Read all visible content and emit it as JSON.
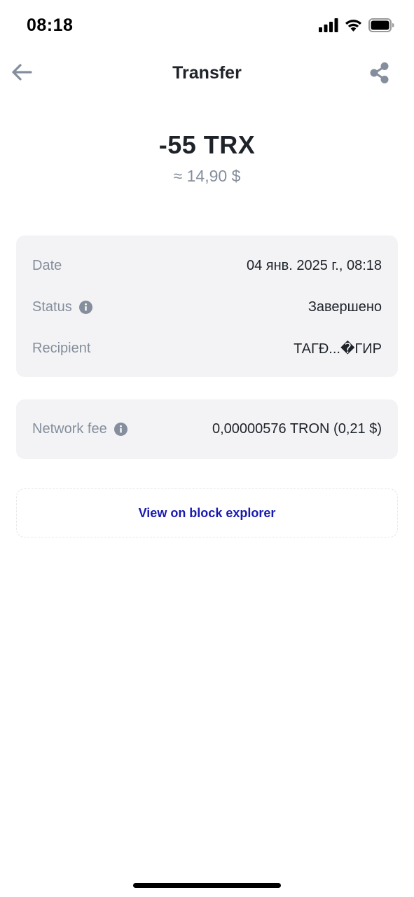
{
  "status_bar": {
    "time": "08:18",
    "icons": [
      "signal-icon",
      "wifi-icon",
      "battery-icon"
    ]
  },
  "header": {
    "title": "Transfer",
    "back_icon": "arrow-left-icon",
    "share_icon": "share-icon"
  },
  "amount": {
    "value": "-55 TRX",
    "fiat": "≈ 14,90 $"
  },
  "details": {
    "date_label": "Date",
    "date_value": "04 янв. 2025 г., 08:18",
    "status_label": "Status",
    "status_value": "Завершено",
    "recipient_label": "Recipient",
    "recipient_value": "ТАГĐ...�ГИР"
  },
  "fee": {
    "label": "Network fee",
    "value": "0,00000576 TRON (0,21 $)"
  },
  "explorer": {
    "label": "View on block explorer"
  },
  "colors": {
    "text_primary": "#1e2329",
    "text_secondary": "#848e9c",
    "card_background": "#f3f3f5",
    "link": "#1a1ab0"
  }
}
